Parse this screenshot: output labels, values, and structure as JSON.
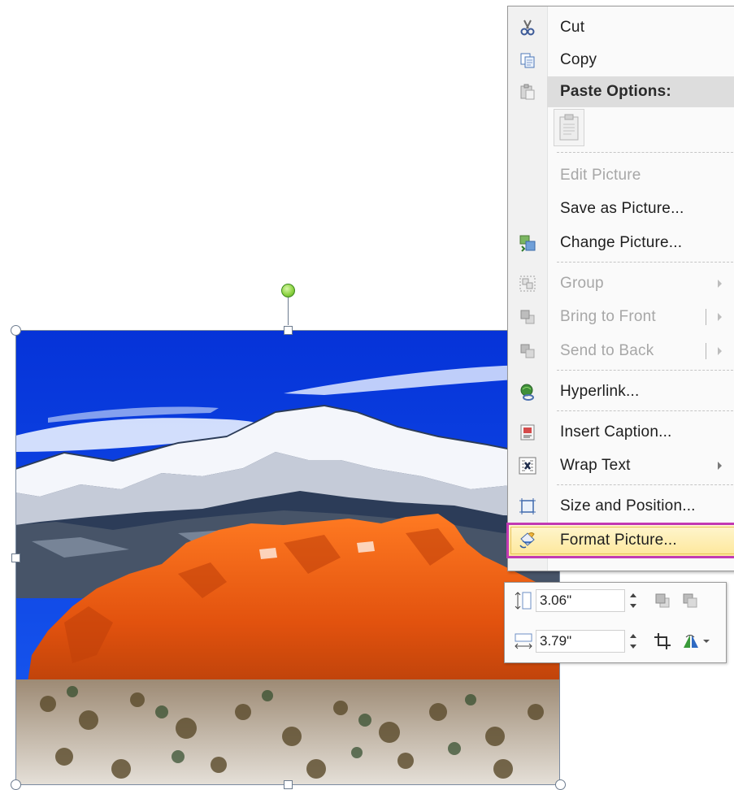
{
  "context_menu": {
    "items": [
      {
        "key": "cut",
        "label": "Cut",
        "icon": "scissors-icon",
        "enabled": true
      },
      {
        "key": "copy",
        "label": "Copy",
        "icon": "copy-icon",
        "enabled": true
      },
      {
        "key": "paste_options",
        "label": "Paste Options:",
        "icon": "paste-icon",
        "enabled": true
      },
      {
        "key": "edit_picture",
        "label": "Edit Picture",
        "enabled": false
      },
      {
        "key": "save_as_picture",
        "label": "Save as Picture...",
        "enabled": true
      },
      {
        "key": "change_picture",
        "label": "Change Picture...",
        "icon": "change-picture-icon",
        "enabled": true
      },
      {
        "key": "group",
        "label": "Group",
        "icon": "group-icon",
        "enabled": false,
        "submenu": true
      },
      {
        "key": "bring_to_front",
        "label": "Bring to Front",
        "icon": "bring-to-front-icon",
        "enabled": false,
        "submenu": true
      },
      {
        "key": "send_to_back",
        "label": "Send to Back",
        "icon": "send-to-back-icon",
        "enabled": false,
        "submenu": true
      },
      {
        "key": "hyperlink",
        "label": "Hyperlink...",
        "icon": "hyperlink-icon",
        "enabled": true
      },
      {
        "key": "insert_caption",
        "label": "Insert Caption...",
        "icon": "insert-caption-icon",
        "enabled": true
      },
      {
        "key": "wrap_text",
        "label": "Wrap Text",
        "icon": "wrap-text-icon",
        "enabled": true,
        "submenu": true
      },
      {
        "key": "size_and_position",
        "label": "Size and Position...",
        "icon": "size-position-icon",
        "enabled": true
      },
      {
        "key": "format_picture",
        "label": "Format Picture...",
        "icon": "format-picture-icon",
        "enabled": true,
        "highlighted": true
      }
    ]
  },
  "mini_toolbar": {
    "height_value": "3.06\"",
    "width_value": "3.79\""
  },
  "colors": {
    "highlight_border": "#c23ab4",
    "highlight_fill": "#fde79a",
    "sky": "#0638e6",
    "rock": "#e65a12"
  }
}
